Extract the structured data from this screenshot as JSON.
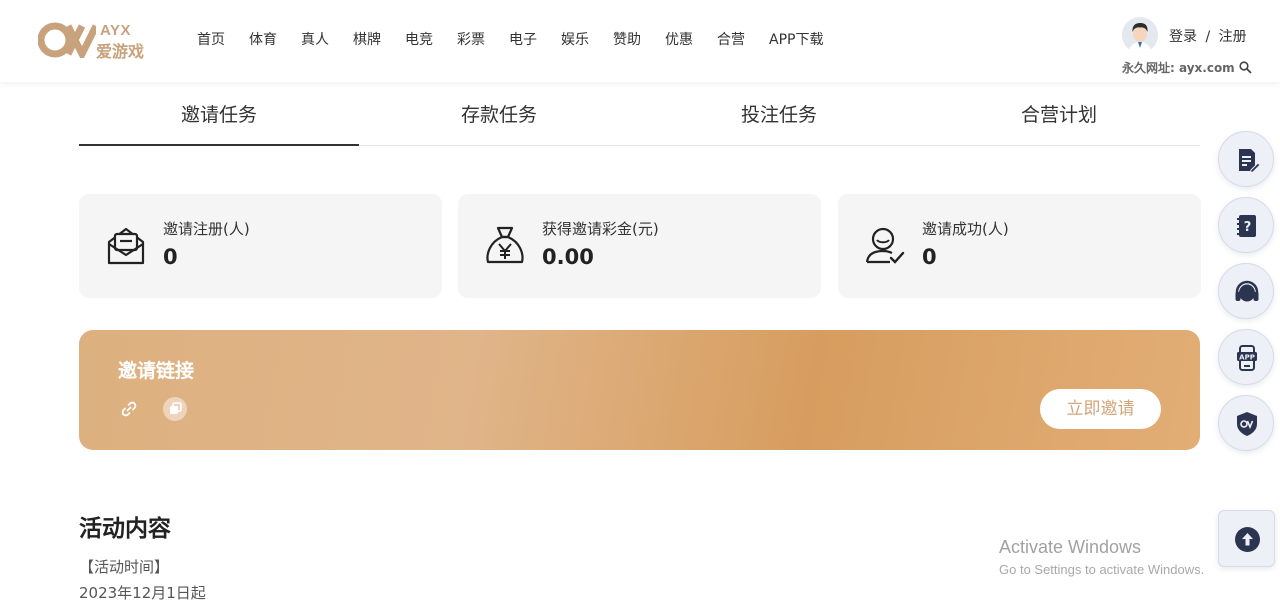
{
  "header": {
    "logo_text": "AYX",
    "logo_cn": "爱游戏",
    "nav": [
      "首页",
      "体育",
      "真人",
      "棋牌",
      "电竞",
      "彩票",
      "电子",
      "娱乐",
      "赞助",
      "优惠",
      "合营",
      "APP下载"
    ],
    "login": "登录",
    "separator": "/",
    "register": "注册",
    "permanent_url": "永久网址: ayx.com"
  },
  "tabs": [
    "邀请任务",
    "存款任务",
    "投注任务",
    "合营计划"
  ],
  "active_tab": 0,
  "stats": [
    {
      "label": "邀请注册(人)",
      "value": "0",
      "icon": "envelope-icon"
    },
    {
      "label": "获得邀请彩金(元)",
      "value": "0.00",
      "icon": "money-bag-icon"
    },
    {
      "label": "邀请成功(人)",
      "value": "0",
      "icon": "user-check-icon"
    }
  ],
  "invite": {
    "title": "邀请链接",
    "button": "立即邀请"
  },
  "activity": {
    "title": "活动内容",
    "time_label": "【活动时间】",
    "time_value": "2023年12月1日起"
  },
  "side_buttons": [
    "notes-icon",
    "help-book-icon",
    "headset-icon",
    "app-download-icon",
    "shield-logo-icon"
  ],
  "watermark": {
    "line1": "Activate Windows",
    "line2": "Go to Settings to activate Windows."
  },
  "colors": {
    "accent": "#d5a57a",
    "banner_start": "#ddb07f",
    "banner_mid": "#d79d5f",
    "side_icon": "#2c3550"
  }
}
